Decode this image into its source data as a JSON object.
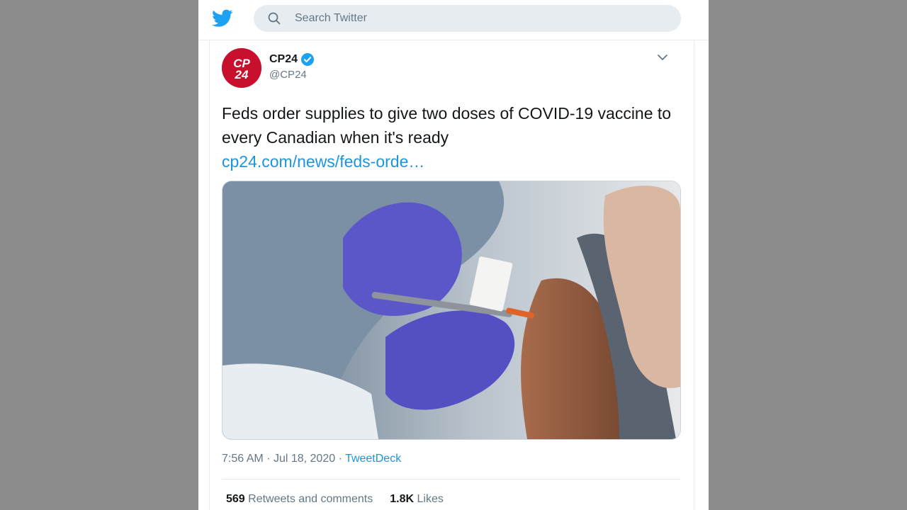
{
  "search": {
    "placeholder": "Search Twitter"
  },
  "tweet": {
    "author_name": "CP24",
    "author_handle": "@CP24",
    "avatar_text": "CP24",
    "text": "Feds order supplies to give two doses of COVID-19 vaccine to every Canadian when it's ready",
    "link": "cp24.com/news/feds-orde…",
    "time": "7:56 AM",
    "date": "Jul 18, 2020",
    "separator": "·",
    "source": "TweetDeck",
    "retweets_count": "569",
    "retweets_label": "Retweets and comments",
    "likes_count": "1.8K",
    "likes_label": "Likes"
  },
  "colors": {
    "brand": "#1da1f2",
    "link": "#1b95e0",
    "avatar_bg": "#c8102e",
    "verified": "#1da1f2"
  },
  "icons": {
    "logo": "twitter-bird-icon",
    "search": "search-icon",
    "verified": "verified-badge-icon",
    "menu": "chevron-down-icon"
  }
}
